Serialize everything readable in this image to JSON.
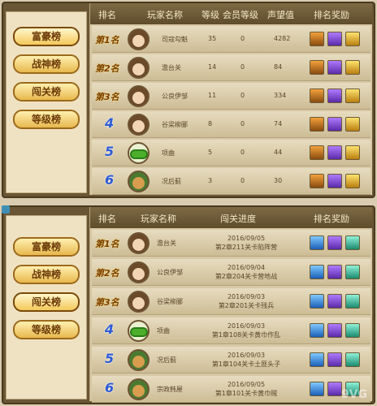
{
  "panel1": {
    "tabs": [
      "富豪榜",
      "战神榜",
      "闯关榜",
      "等级榜"
    ],
    "active_tab": 0,
    "headers": [
      "排名",
      "玩家名称",
      "等级",
      "会员等级",
      "声望值",
      "排名奖励"
    ],
    "rows": [
      {
        "rank": "第1名",
        "name": "司寇勾魁",
        "level": "35",
        "vip": "0",
        "prestige": "4282",
        "avatar": "portrait",
        "rewards": [
          "orange",
          "purple",
          "gold"
        ]
      },
      {
        "rank": "第2名",
        "name": "澹台关",
        "level": "14",
        "vip": "0",
        "prestige": "84",
        "avatar": "portrait",
        "rewards": [
          "orange",
          "purple",
          "gold"
        ]
      },
      {
        "rank": "第3名",
        "name": "公良伊邹",
        "level": "11",
        "vip": "0",
        "prestige": "334",
        "avatar": "portrait",
        "rewards": [
          "orange",
          "purple",
          "gold"
        ]
      },
      {
        "rank": "4",
        "name": "谷梁柳郦",
        "level": "8",
        "vip": "0",
        "prestige": "74",
        "avatar": "portrait",
        "rewards": [
          "orange",
          "purple",
          "gold"
        ]
      },
      {
        "rank": "5",
        "name": "项曲",
        "level": "5",
        "vip": "0",
        "prestige": "44",
        "avatar": "green",
        "rewards": [
          "orange",
          "purple",
          "gold"
        ]
      },
      {
        "rank": "6",
        "name": "况后蓟",
        "level": "3",
        "vip": "0",
        "prestige": "30",
        "avatar": "monster",
        "rewards": [
          "orange",
          "purple",
          "gold"
        ]
      }
    ]
  },
  "panel2": {
    "tabs": [
      "富豪榜",
      "战神榜",
      "闯关榜",
      "等级榜"
    ],
    "active_tab": 2,
    "headers": [
      "排名",
      "玩家名称",
      "闯关进度",
      "排名奖励"
    ],
    "rows": [
      {
        "rank": "第1名",
        "name": "澹台关",
        "date": "2016/09/05",
        "progress": "第2章211关卡陷阵营",
        "avatar": "portrait",
        "rewards": [
          "blue",
          "purple",
          "teal"
        ]
      },
      {
        "rank": "第2名",
        "name": "公良伊邹",
        "date": "2016/09/04",
        "progress": "第2章204关卡营地战",
        "avatar": "portrait",
        "rewards": [
          "blue",
          "purple",
          "teal"
        ]
      },
      {
        "rank": "第3名",
        "name": "谷梁柳郦",
        "date": "2016/09/03",
        "progress": "第2章201关卡残兵",
        "avatar": "portrait",
        "rewards": [
          "blue",
          "purple",
          "teal"
        ]
      },
      {
        "rank": "4",
        "name": "项曲",
        "date": "2016/09/03",
        "progress": "第1章108关卡黄巾作乱",
        "avatar": "green",
        "rewards": [
          "blue",
          "purple",
          "teal"
        ]
      },
      {
        "rank": "5",
        "name": "况后蓟",
        "date": "2016/09/03",
        "progress": "第1章104关卡土匪头子",
        "avatar": "monster",
        "rewards": [
          "blue",
          "purple",
          "teal"
        ]
      },
      {
        "rank": "6",
        "name": "宗政韩屋",
        "date": "2016/09/05",
        "progress": "第1章101关卡黄巾贼",
        "avatar": "monster",
        "rewards": [
          "blue",
          "purple",
          "teal"
        ]
      }
    ]
  },
  "watermark": "9VG"
}
